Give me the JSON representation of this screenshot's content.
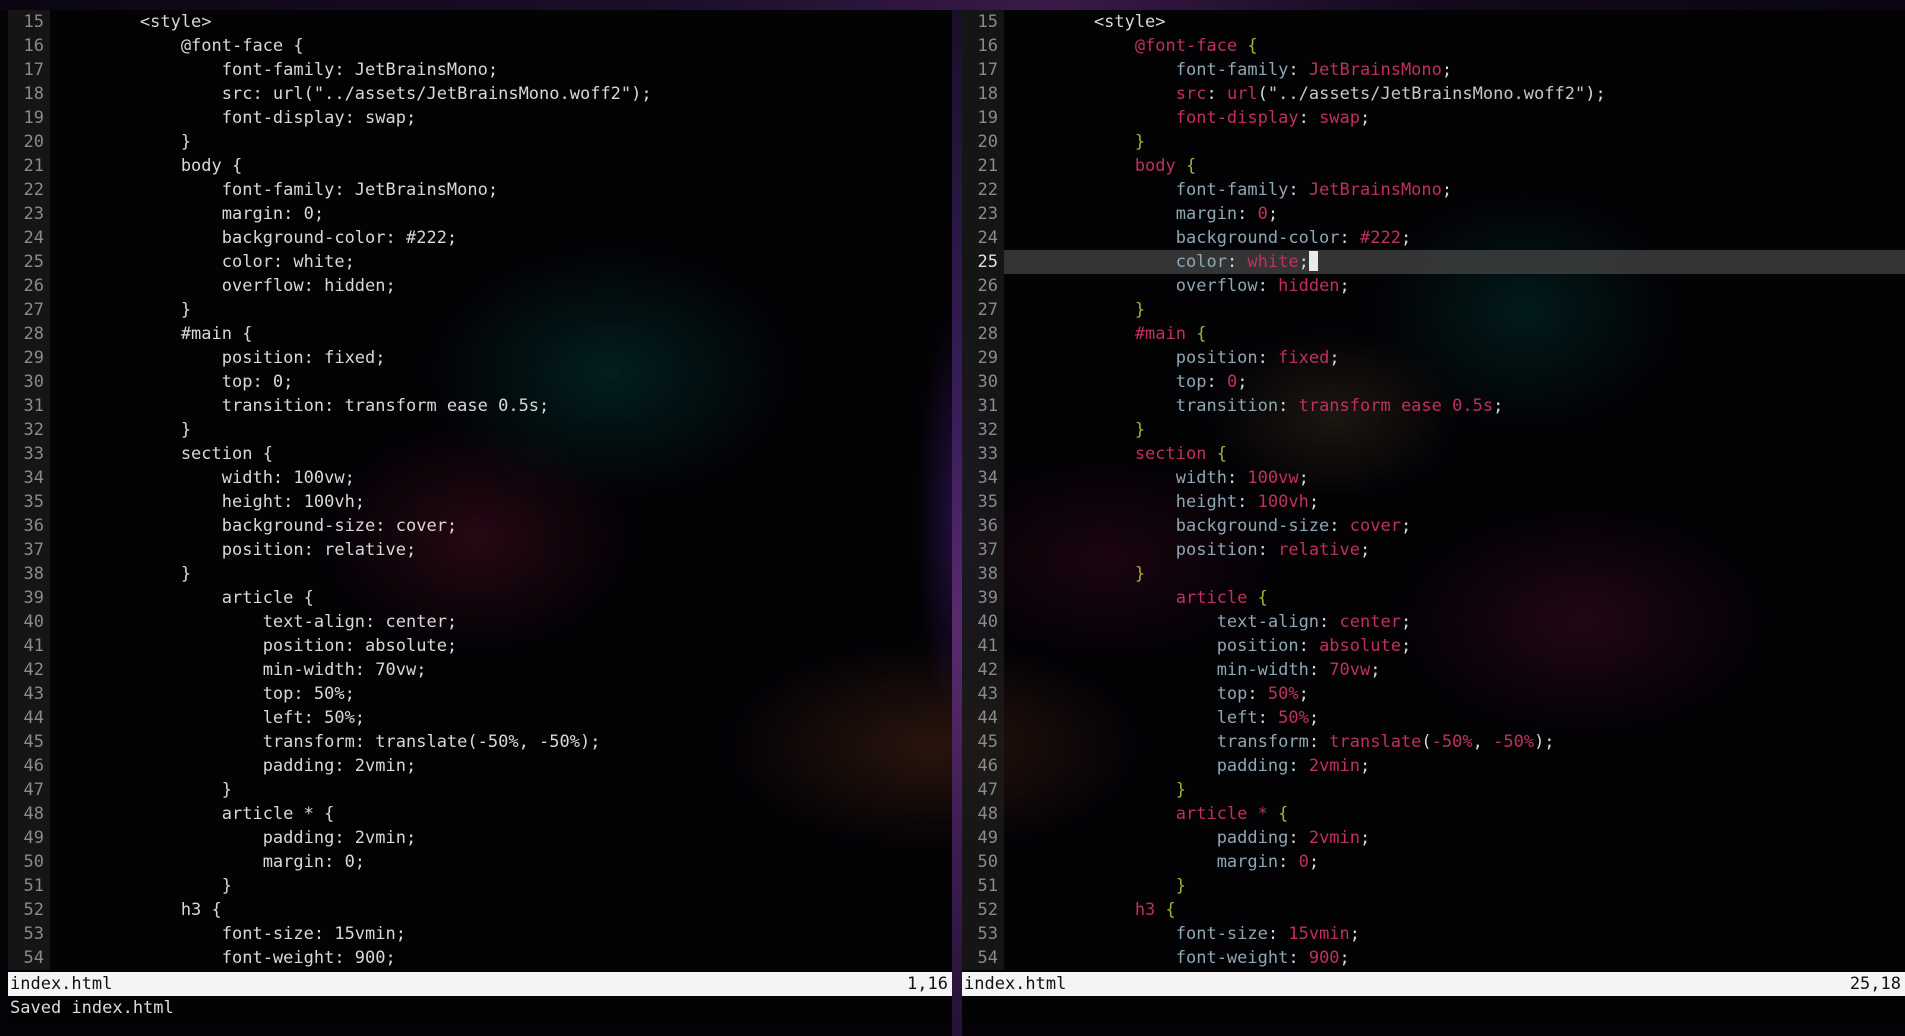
{
  "panes": [
    {
      "id": "left",
      "status": {
        "filename": "index.html",
        "position": "1,16"
      },
      "cmdline": "Saved index.html",
      "lines": [
        {
          "num": "15",
          "text": "        <style>"
        },
        {
          "num": "16",
          "text": "            @font-face {"
        },
        {
          "num": "17",
          "text": "                font-family: JetBrainsMono;"
        },
        {
          "num": "18",
          "text": "                src: url(\"../assets/JetBrainsMono.woff2\");"
        },
        {
          "num": "19",
          "text": "                font-display: swap;"
        },
        {
          "num": "20",
          "text": "            }"
        },
        {
          "num": "21",
          "text": "            body {"
        },
        {
          "num": "22",
          "text": "                font-family: JetBrainsMono;"
        },
        {
          "num": "23",
          "text": "                margin: 0;"
        },
        {
          "num": "24",
          "text": "                background-color: #222;"
        },
        {
          "num": "25",
          "text": "                color: white;"
        },
        {
          "num": "26",
          "text": "                overflow: hidden;"
        },
        {
          "num": "27",
          "text": "            }"
        },
        {
          "num": "28",
          "text": "            #main {"
        },
        {
          "num": "29",
          "text": "                position: fixed;"
        },
        {
          "num": "30",
          "text": "                top: 0;"
        },
        {
          "num": "31",
          "text": "                transition: transform ease 0.5s;"
        },
        {
          "num": "32",
          "text": "            }"
        },
        {
          "num": "33",
          "text": "            section {"
        },
        {
          "num": "34",
          "text": "                width: 100vw;"
        },
        {
          "num": "35",
          "text": "                height: 100vh;"
        },
        {
          "num": "36",
          "text": "                background-size: cover;"
        },
        {
          "num": "37",
          "text": "                position: relative;"
        },
        {
          "num": "38",
          "text": "            }"
        },
        {
          "num": "39",
          "text": "                article {"
        },
        {
          "num": "40",
          "text": "                    text-align: center;"
        },
        {
          "num": "41",
          "text": "                    position: absolute;"
        },
        {
          "num": "42",
          "text": "                    min-width: 70vw;"
        },
        {
          "num": "43",
          "text": "                    top: 50%;"
        },
        {
          "num": "44",
          "text": "                    left: 50%;"
        },
        {
          "num": "45",
          "text": "                    transform: translate(-50%, -50%);"
        },
        {
          "num": "46",
          "text": "                    padding: 2vmin;"
        },
        {
          "num": "47",
          "text": "                }"
        },
        {
          "num": "48",
          "text": "                article * {"
        },
        {
          "num": "49",
          "text": "                    padding: 2vmin;"
        },
        {
          "num": "50",
          "text": "                    margin: 0;"
        },
        {
          "num": "51",
          "text": "                }"
        },
        {
          "num": "52",
          "text": "            h3 {"
        },
        {
          "num": "53",
          "text": "                font-size: 15vmin;"
        },
        {
          "num": "54",
          "text": "                font-weight: 900;"
        }
      ]
    },
    {
      "id": "right",
      "status": {
        "filename": "index.html",
        "position": "25,18"
      },
      "current_line": "25",
      "syntax_colors": {
        "selector": "#c0305e",
        "brace": "#a6b03a",
        "property": "#8fa7b3",
        "value": "#c0305e"
      },
      "lines": [
        {
          "num": "15",
          "tokens": [
            {
              "t": "tag",
              "v": "        <style>"
            }
          ]
        },
        {
          "num": "16",
          "tokens": [
            {
              "t": "sel",
              "v": "            @font-face "
            },
            {
              "t": "brace",
              "v": "{"
            }
          ]
        },
        {
          "num": "17",
          "tokens": [
            {
              "t": "prop",
              "v": "                font-family"
            },
            {
              "t": "punct",
              "v": ": "
            },
            {
              "t": "val",
              "v": "JetBrainsMono"
            },
            {
              "t": "punct",
              "v": ";"
            }
          ]
        },
        {
          "num": "18",
          "tokens": [
            {
              "t": "val",
              "v": "                src"
            },
            {
              "t": "punct",
              "v": ": "
            },
            {
              "t": "val",
              "v": "url"
            },
            {
              "t": "punct",
              "v": "("
            },
            {
              "t": "str",
              "v": "\"../assets/JetBrainsMono.woff2\""
            },
            {
              "t": "punct",
              "v": ");"
            }
          ]
        },
        {
          "num": "19",
          "tokens": [
            {
              "t": "val",
              "v": "                font-display"
            },
            {
              "t": "punct",
              "v": ": "
            },
            {
              "t": "val",
              "v": "swap"
            },
            {
              "t": "punct",
              "v": ";"
            }
          ]
        },
        {
          "num": "20",
          "tokens": [
            {
              "t": "brace",
              "v": "            }"
            }
          ]
        },
        {
          "num": "21",
          "tokens": [
            {
              "t": "sel",
              "v": "            body "
            },
            {
              "t": "brace",
              "v": "{"
            }
          ]
        },
        {
          "num": "22",
          "tokens": [
            {
              "t": "prop",
              "v": "                font-family"
            },
            {
              "t": "punct",
              "v": ": "
            },
            {
              "t": "val",
              "v": "JetBrainsMono"
            },
            {
              "t": "punct",
              "v": ";"
            }
          ]
        },
        {
          "num": "23",
          "tokens": [
            {
              "t": "prop",
              "v": "                margin"
            },
            {
              "t": "punct",
              "v": ": "
            },
            {
              "t": "num",
              "v": "0"
            },
            {
              "t": "punct",
              "v": ";"
            }
          ]
        },
        {
          "num": "24",
          "tokens": [
            {
              "t": "prop",
              "v": "                background-color"
            },
            {
              "t": "punct",
              "v": ": "
            },
            {
              "t": "val",
              "v": "#222"
            },
            {
              "t": "punct",
              "v": ";"
            }
          ]
        },
        {
          "num": "25",
          "tokens": [
            {
              "t": "prop",
              "v": "                color"
            },
            {
              "t": "punct",
              "v": ": "
            },
            {
              "t": "val",
              "v": "white"
            },
            {
              "t": "punct",
              "v": ";"
            }
          ]
        },
        {
          "num": "26",
          "tokens": [
            {
              "t": "prop",
              "v": "                overflow"
            },
            {
              "t": "punct",
              "v": ": "
            },
            {
              "t": "val",
              "v": "hidden"
            },
            {
              "t": "punct",
              "v": ";"
            }
          ]
        },
        {
          "num": "27",
          "tokens": [
            {
              "t": "brace",
              "v": "            }"
            }
          ]
        },
        {
          "num": "28",
          "tokens": [
            {
              "t": "sel",
              "v": "            #main "
            },
            {
              "t": "brace",
              "v": "{"
            }
          ]
        },
        {
          "num": "29",
          "tokens": [
            {
              "t": "prop",
              "v": "                position"
            },
            {
              "t": "punct",
              "v": ": "
            },
            {
              "t": "val",
              "v": "fixed"
            },
            {
              "t": "punct",
              "v": ";"
            }
          ]
        },
        {
          "num": "30",
          "tokens": [
            {
              "t": "prop",
              "v": "                top"
            },
            {
              "t": "punct",
              "v": ": "
            },
            {
              "t": "num",
              "v": "0"
            },
            {
              "t": "punct",
              "v": ";"
            }
          ]
        },
        {
          "num": "31",
          "tokens": [
            {
              "t": "prop",
              "v": "                transition"
            },
            {
              "t": "punct",
              "v": ": "
            },
            {
              "t": "val",
              "v": "transform ease 0.5s"
            },
            {
              "t": "punct",
              "v": ";"
            }
          ]
        },
        {
          "num": "32",
          "tokens": [
            {
              "t": "brace",
              "v": "            }"
            }
          ]
        },
        {
          "num": "33",
          "tokens": [
            {
              "t": "sel",
              "v": "            section "
            },
            {
              "t": "brace",
              "v": "{"
            }
          ]
        },
        {
          "num": "34",
          "tokens": [
            {
              "t": "prop",
              "v": "                width"
            },
            {
              "t": "punct",
              "v": ": "
            },
            {
              "t": "num",
              "v": "100vw"
            },
            {
              "t": "punct",
              "v": ";"
            }
          ]
        },
        {
          "num": "35",
          "tokens": [
            {
              "t": "prop",
              "v": "                height"
            },
            {
              "t": "punct",
              "v": ": "
            },
            {
              "t": "num",
              "v": "100vh"
            },
            {
              "t": "punct",
              "v": ";"
            }
          ]
        },
        {
          "num": "36",
          "tokens": [
            {
              "t": "prop",
              "v": "                background-size"
            },
            {
              "t": "punct",
              "v": ": "
            },
            {
              "t": "val",
              "v": "cover"
            },
            {
              "t": "punct",
              "v": ";"
            }
          ]
        },
        {
          "num": "37",
          "tokens": [
            {
              "t": "prop",
              "v": "                position"
            },
            {
              "t": "punct",
              "v": ": "
            },
            {
              "t": "val",
              "v": "relative"
            },
            {
              "t": "punct",
              "v": ";"
            }
          ]
        },
        {
          "num": "38",
          "tokens": [
            {
              "t": "brace",
              "v": "            }"
            }
          ]
        },
        {
          "num": "39",
          "tokens": [
            {
              "t": "sel",
              "v": "                article "
            },
            {
              "t": "brace",
              "v": "{"
            }
          ]
        },
        {
          "num": "40",
          "tokens": [
            {
              "t": "prop",
              "v": "                    text-align"
            },
            {
              "t": "punct",
              "v": ": "
            },
            {
              "t": "val",
              "v": "center"
            },
            {
              "t": "punct",
              "v": ";"
            }
          ]
        },
        {
          "num": "41",
          "tokens": [
            {
              "t": "prop",
              "v": "                    position"
            },
            {
              "t": "punct",
              "v": ": "
            },
            {
              "t": "val",
              "v": "absolute"
            },
            {
              "t": "punct",
              "v": ";"
            }
          ]
        },
        {
          "num": "42",
          "tokens": [
            {
              "t": "prop",
              "v": "                    min-width"
            },
            {
              "t": "punct",
              "v": ": "
            },
            {
              "t": "num",
              "v": "70vw"
            },
            {
              "t": "punct",
              "v": ";"
            }
          ]
        },
        {
          "num": "43",
          "tokens": [
            {
              "t": "prop",
              "v": "                    top"
            },
            {
              "t": "punct",
              "v": ": "
            },
            {
              "t": "num",
              "v": "50%"
            },
            {
              "t": "punct",
              "v": ";"
            }
          ]
        },
        {
          "num": "44",
          "tokens": [
            {
              "t": "prop",
              "v": "                    left"
            },
            {
              "t": "punct",
              "v": ": "
            },
            {
              "t": "num",
              "v": "50%"
            },
            {
              "t": "punct",
              "v": ";"
            }
          ]
        },
        {
          "num": "45",
          "tokens": [
            {
              "t": "prop",
              "v": "                    transform"
            },
            {
              "t": "punct",
              "v": ": "
            },
            {
              "t": "val",
              "v": "translate"
            },
            {
              "t": "punct",
              "v": "("
            },
            {
              "t": "num",
              "v": "-50%"
            },
            {
              "t": "punct",
              "v": ", "
            },
            {
              "t": "num",
              "v": "-50%"
            },
            {
              "t": "punct",
              "v": ");"
            }
          ]
        },
        {
          "num": "46",
          "tokens": [
            {
              "t": "prop",
              "v": "                    padding"
            },
            {
              "t": "punct",
              "v": ": "
            },
            {
              "t": "num",
              "v": "2vmin"
            },
            {
              "t": "punct",
              "v": ";"
            }
          ]
        },
        {
          "num": "47",
          "tokens": [
            {
              "t": "brace",
              "v": "                }"
            }
          ]
        },
        {
          "num": "48",
          "tokens": [
            {
              "t": "sel",
              "v": "                article * "
            },
            {
              "t": "brace",
              "v": "{"
            }
          ]
        },
        {
          "num": "49",
          "tokens": [
            {
              "t": "prop",
              "v": "                    padding"
            },
            {
              "t": "punct",
              "v": ": "
            },
            {
              "t": "num",
              "v": "2vmin"
            },
            {
              "t": "punct",
              "v": ";"
            }
          ]
        },
        {
          "num": "50",
          "tokens": [
            {
              "t": "prop",
              "v": "                    margin"
            },
            {
              "t": "punct",
              "v": ": "
            },
            {
              "t": "num",
              "v": "0"
            },
            {
              "t": "punct",
              "v": ";"
            }
          ]
        },
        {
          "num": "51",
          "tokens": [
            {
              "t": "brace",
              "v": "                }"
            }
          ]
        },
        {
          "num": "52",
          "tokens": [
            {
              "t": "sel",
              "v": "            h3 "
            },
            {
              "t": "brace",
              "v": "{"
            }
          ]
        },
        {
          "num": "53",
          "tokens": [
            {
              "t": "prop",
              "v": "                font-size"
            },
            {
              "t": "punct",
              "v": ": "
            },
            {
              "t": "num",
              "v": "15vmin"
            },
            {
              "t": "punct",
              "v": ";"
            }
          ]
        },
        {
          "num": "54",
          "tokens": [
            {
              "t": "prop",
              "v": "                font-weight"
            },
            {
              "t": "punct",
              "v": ": "
            },
            {
              "t": "num",
              "v": "900"
            },
            {
              "t": "punct",
              "v": ";"
            }
          ]
        }
      ]
    }
  ]
}
